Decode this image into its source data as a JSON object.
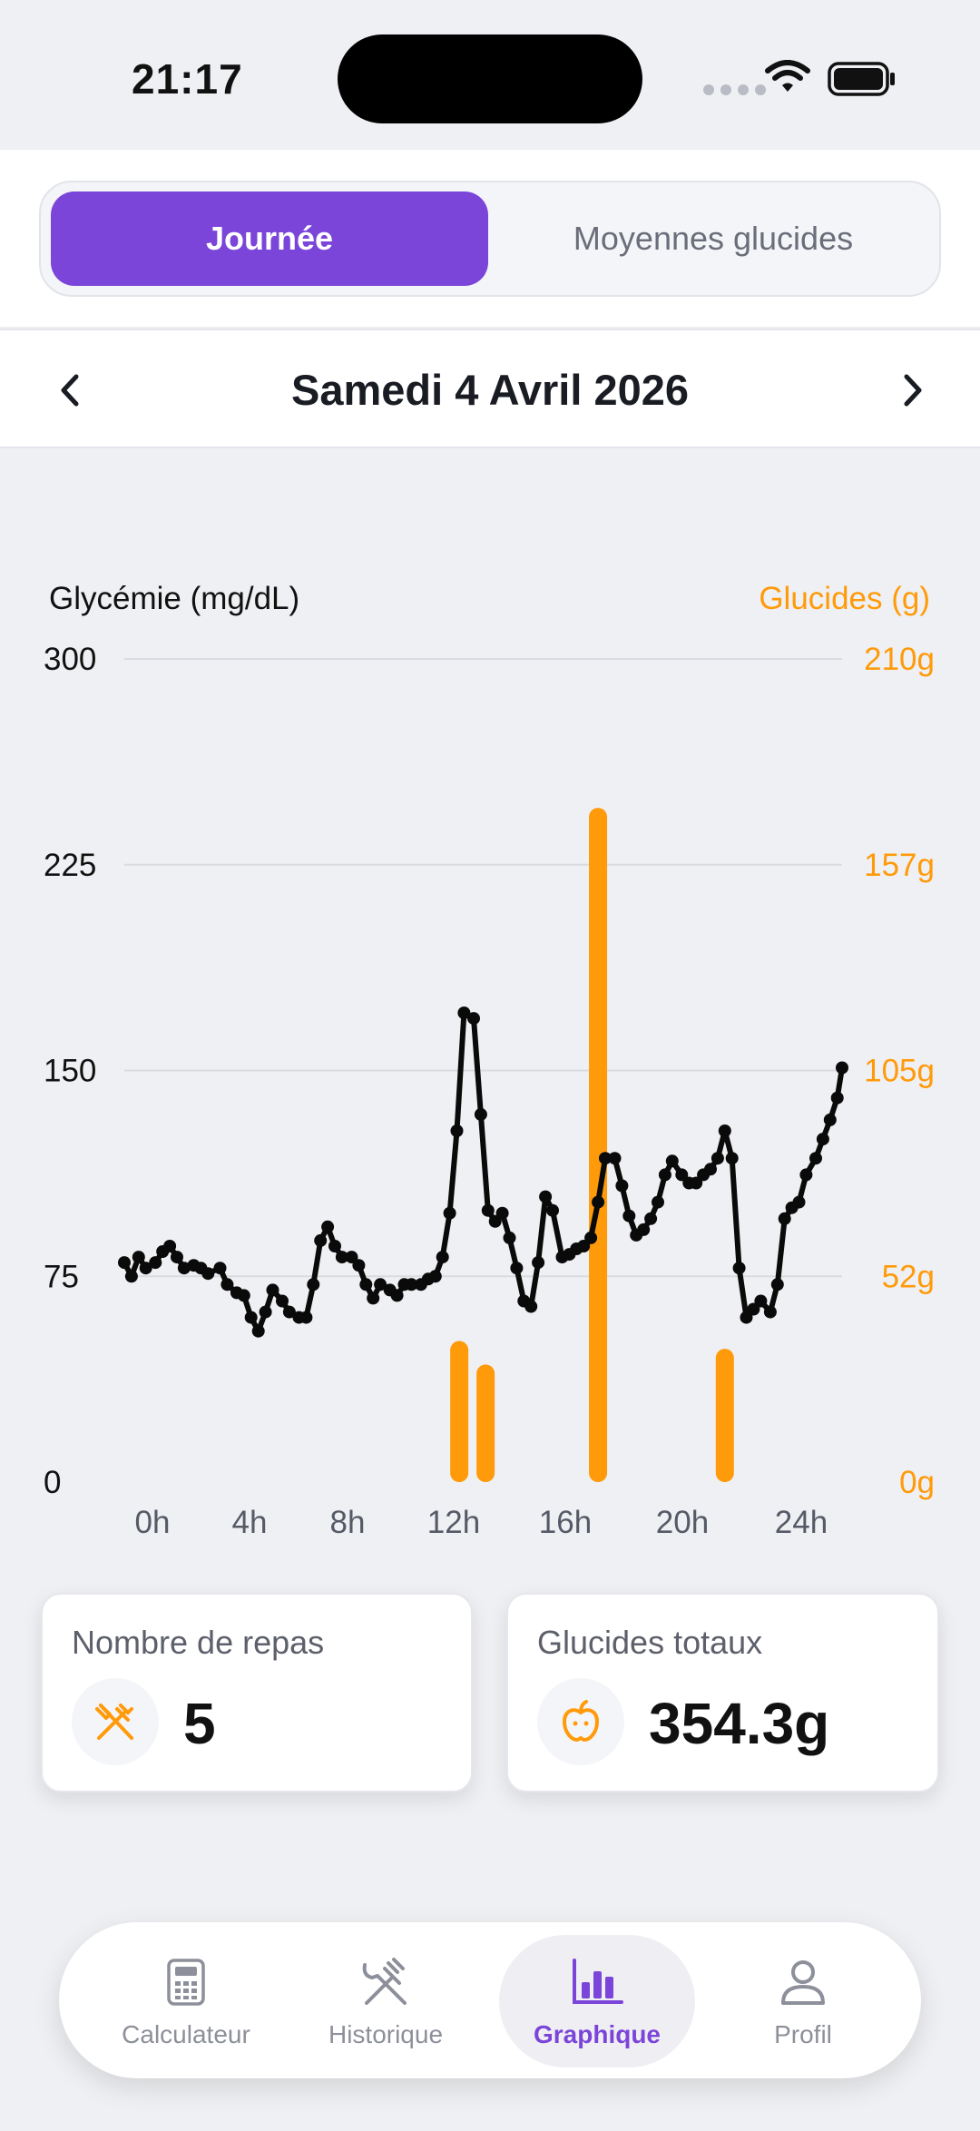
{
  "status_bar": {
    "time": "21:17"
  },
  "segmented": {
    "active": "Journée",
    "inactive": "Moyennes glucides"
  },
  "date_nav": {
    "title": "Samedi 4 Avril 2026"
  },
  "chart_data": {
    "type": "line",
    "left_axis_label": "Glycémie (mg/dL)",
    "right_axis_label": "Glucides (g)",
    "y_ticks": [
      "300",
      "225",
      "150",
      "75",
      "0"
    ],
    "y2_ticks": [
      "210g",
      "157g",
      "105g",
      "52g",
      "0g"
    ],
    "x_ticks": [
      "0h",
      "4h",
      "8h",
      "12h",
      "16h",
      "20h",
      "24h"
    ],
    "ylim": [
      0,
      300
    ],
    "y2lim": [
      0,
      210
    ],
    "xlim": [
      0,
      25.7
    ],
    "grid": true,
    "line_color": "#0a0a0a",
    "bar_color": "#ff9a0a",
    "series": [
      {
        "name": "Glycémie",
        "type": "line",
        "points": [
          [
            0.0,
            80
          ],
          [
            0.3,
            75
          ],
          [
            0.6,
            82
          ],
          [
            0.9,
            78
          ],
          [
            1.3,
            80
          ],
          [
            1.6,
            84
          ],
          [
            1.9,
            86
          ],
          [
            2.2,
            82
          ],
          [
            2.5,
            78
          ],
          [
            2.9,
            79
          ],
          [
            3.2,
            78
          ],
          [
            3.5,
            76
          ],
          [
            4.0,
            78
          ],
          [
            4.3,
            72
          ],
          [
            4.7,
            69
          ],
          [
            5.0,
            68
          ],
          [
            5.3,
            60
          ],
          [
            5.6,
            55
          ],
          [
            5.9,
            62
          ],
          [
            6.2,
            70
          ],
          [
            6.6,
            66
          ],
          [
            6.9,
            62
          ],
          [
            7.3,
            60
          ],
          [
            7.6,
            60
          ],
          [
            7.9,
            72
          ],
          [
            8.2,
            88
          ],
          [
            8.5,
            93
          ],
          [
            8.8,
            86
          ],
          [
            9.1,
            82
          ],
          [
            9.5,
            82
          ],
          [
            9.8,
            79
          ],
          [
            10.1,
            72
          ],
          [
            10.4,
            67
          ],
          [
            10.7,
            72
          ],
          [
            11.1,
            70
          ],
          [
            11.4,
            68
          ],
          [
            11.7,
            72
          ],
          [
            12.0,
            72
          ],
          [
            12.4,
            72
          ],
          [
            12.7,
            74
          ],
          [
            13.0,
            75
          ],
          [
            13.3,
            82
          ],
          [
            13.6,
            98
          ],
          [
            13.9,
            128
          ],
          [
            14.2,
            171
          ],
          [
            14.6,
            169
          ],
          [
            14.9,
            134
          ],
          [
            15.2,
            99
          ],
          [
            15.5,
            95
          ],
          [
            15.8,
            98
          ],
          [
            16.1,
            89
          ],
          [
            16.4,
            78
          ],
          [
            16.7,
            66
          ],
          [
            17.0,
            64
          ],
          [
            17.3,
            80
          ],
          [
            17.6,
            104
          ],
          [
            17.9,
            99
          ],
          [
            18.3,
            82
          ],
          [
            18.6,
            83
          ],
          [
            18.9,
            85
          ],
          [
            19.2,
            86
          ],
          [
            19.5,
            89
          ],
          [
            19.8,
            102
          ],
          [
            20.1,
            118
          ],
          [
            20.5,
            118
          ],
          [
            20.8,
            108
          ],
          [
            21.1,
            97
          ],
          [
            21.4,
            90
          ],
          [
            21.7,
            92
          ],
          [
            22.0,
            96
          ],
          [
            22.3,
            102
          ],
          [
            22.6,
            112
          ],
          [
            22.9,
            117
          ],
          [
            23.3,
            112
          ],
          [
            23.6,
            109
          ],
          [
            23.9,
            109
          ],
          [
            24.2,
            112
          ],
          [
            24.5,
            114
          ],
          [
            24.8,
            118
          ],
          [
            25.1,
            128
          ],
          [
            25.4,
            118
          ],
          [
            25.7,
            78
          ],
          [
            26.0,
            60
          ],
          [
            26.3,
            63
          ],
          [
            26.6,
            66
          ],
          [
            27.0,
            62
          ],
          [
            27.3,
            72
          ],
          [
            27.6,
            96
          ],
          [
            27.9,
            100
          ],
          [
            28.2,
            102
          ],
          [
            28.5,
            112
          ],
          [
            28.9,
            118
          ],
          [
            29.2,
            125
          ],
          [
            29.5,
            132
          ],
          [
            29.8,
            140
          ],
          [
            30.0,
            151
          ]
        ]
      },
      {
        "name": "Glucides",
        "type": "bar",
        "points": [
          [
            14.0,
            36
          ],
          [
            15.1,
            30
          ],
          [
            19.8,
            172
          ],
          [
            25.1,
            34
          ]
        ]
      }
    ]
  },
  "stats": {
    "meals_label": "Nombre de repas",
    "meals_value": "5",
    "carbs_label": "Glucides totaux",
    "carbs_value": "354.3g"
  },
  "tab_bar": {
    "items": [
      {
        "label": "Calculateur",
        "icon": "calculator-icon"
      },
      {
        "label": "Historique",
        "icon": "fork-knife-icon"
      },
      {
        "label": "Graphique",
        "icon": "bar-chart-icon"
      },
      {
        "label": "Profil",
        "icon": "person-icon"
      }
    ]
  },
  "colors": {
    "accent": "#7b45d9",
    "orange": "#ff9a0a"
  }
}
